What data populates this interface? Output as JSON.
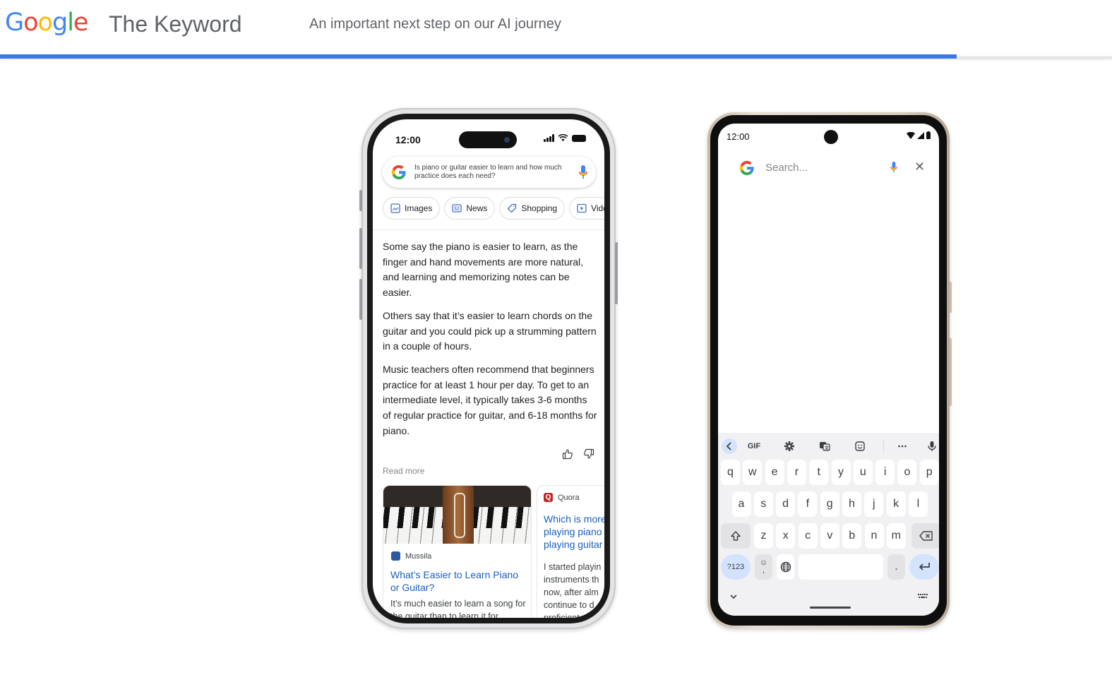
{
  "header": {
    "logo": [
      "G",
      "o",
      "o",
      "g",
      "l",
      "e"
    ],
    "site_title": "The Keyword",
    "article_title": "An important next step on our AI journey",
    "reading_progress_percent": 86,
    "colors": {
      "progress": "#3b78e7",
      "google_blue": "#4285F4",
      "google_red": "#EA4335",
      "google_yellow": "#FBBC05",
      "google_green": "#34A853"
    }
  },
  "iphone": {
    "status": {
      "time": "12:00"
    },
    "search": {
      "query": "Is piano or guitar easier to learn and how much practice does each need?"
    },
    "chips": [
      {
        "label": "Images",
        "icon": "image-icon"
      },
      {
        "label": "News",
        "icon": "news-icon"
      },
      {
        "label": "Shopping",
        "icon": "tag-icon"
      },
      {
        "label": "Vide",
        "icon": "video-icon"
      }
    ],
    "answer": [
      "Some say the piano is easier to learn, as the finger and hand movements are more natural, and learning and memorizing notes can be easier.",
      "Others say that it’s easier to learn chords on the guitar and you could pick up a strumming pattern in a couple of hours.",
      "Music teachers often recommend that beginners practice for at least 1 hour per day. To get to an intermediate level, it typically takes 3-6 months of regular practice for guitar, and 6-18 months for piano."
    ],
    "read_more": "Read more",
    "cards": [
      {
        "source": "Mussila",
        "source_icon": "mussila-icon",
        "title": "What’s Easier to Learn Piano or Guitar?",
        "snippet": "It’s much easier to learn a song for the guitar than to learn it for"
      },
      {
        "source": "Quora",
        "source_icon": "Q",
        "title": "Which is more playing piano playing guitar",
        "snippet": "I started playin instruments th now, after alm continue to d proficient"
      }
    ]
  },
  "pixel": {
    "status": {
      "time": "12:00"
    },
    "search": {
      "placeholder": "Search..."
    },
    "keyboard": {
      "toolbar": {
        "gif": "GIF"
      },
      "row1": [
        "q",
        "w",
        "e",
        "r",
        "t",
        "y",
        "u",
        "i",
        "o",
        "p"
      ],
      "row2": [
        "a",
        "s",
        "d",
        "f",
        "g",
        "h",
        "j",
        "k",
        "l"
      ],
      "row3": [
        "z",
        "x",
        "c",
        "v",
        "b",
        "n",
        "m"
      ],
      "symbols": "?123",
      "period": "."
    }
  }
}
